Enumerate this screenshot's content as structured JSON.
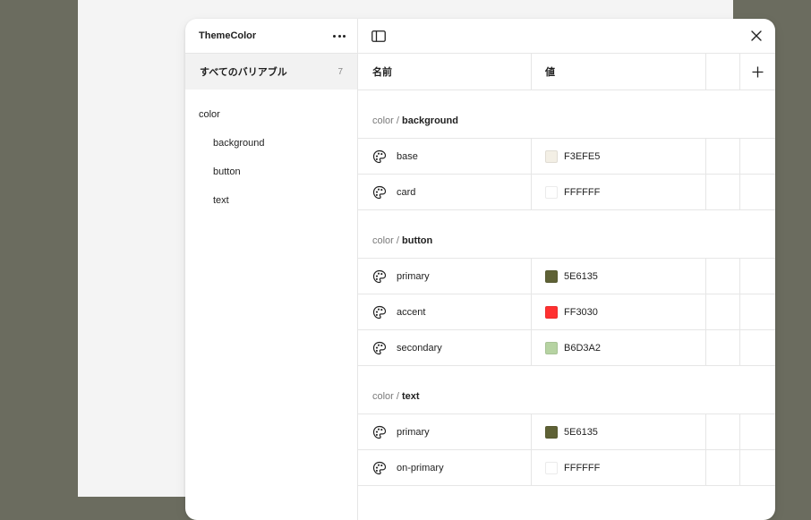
{
  "sidebar": {
    "title": "ThemeColor",
    "all_label": "すべてのバリアブル",
    "all_count": "7",
    "tree": [
      {
        "label": "color",
        "level": "root"
      },
      {
        "label": "background",
        "level": "child"
      },
      {
        "label": "button",
        "level": "child"
      },
      {
        "label": "text",
        "level": "child"
      }
    ]
  },
  "table": {
    "col_name": "名前",
    "col_value": "値",
    "groups": [
      {
        "prefix": "color / ",
        "name": "background",
        "rows": [
          {
            "name": "base",
            "value": "F3EFE5",
            "color": "#F3EFE5"
          },
          {
            "name": "card",
            "value": "FFFFFF",
            "color": "#FFFFFF"
          }
        ]
      },
      {
        "prefix": "color / ",
        "name": "button",
        "rows": [
          {
            "name": "primary",
            "value": "5E6135",
            "color": "#5E6135"
          },
          {
            "name": "accent",
            "value": "FF3030",
            "color": "#FF3030"
          },
          {
            "name": "secondary",
            "value": "B6D3A2",
            "color": "#B6D3A2"
          }
        ]
      },
      {
        "prefix": "color / ",
        "name": "text",
        "rows": [
          {
            "name": "primary",
            "value": "5E6135",
            "color": "#5E6135"
          },
          {
            "name": "on-primary",
            "value": "FFFFFF",
            "color": "#FFFFFF"
          }
        ]
      }
    ]
  },
  "icons": {
    "more": "more-horizontal-icon",
    "sidebar_toggle": "sidebar-toggle-icon",
    "close": "close-icon",
    "add": "plus-icon",
    "variable": "palette-icon"
  }
}
